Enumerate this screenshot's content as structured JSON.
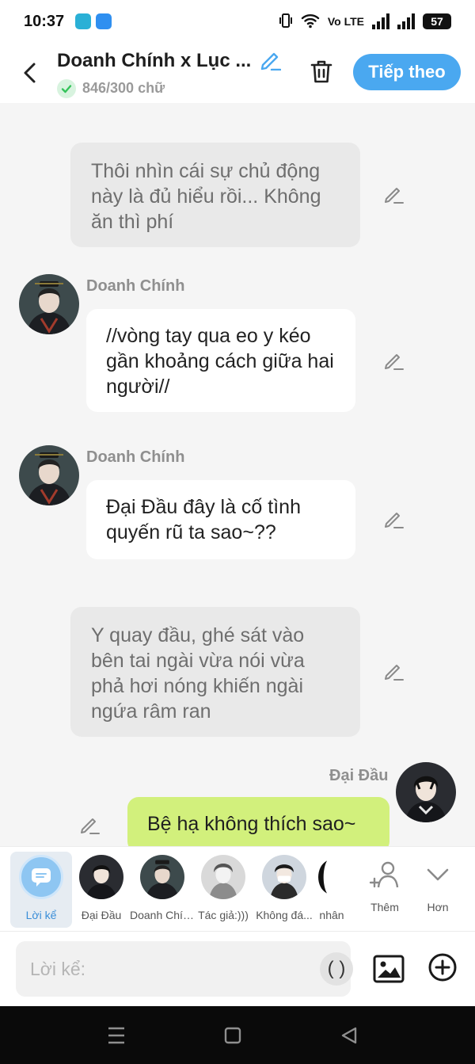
{
  "status_bar": {
    "time": "10:37",
    "network_label": "Vo LTE",
    "battery": "57"
  },
  "header": {
    "title": "Doanh Chính x Lục ...",
    "word_count": "846/300 chữ",
    "next_button": "Tiếp theo"
  },
  "messages": [
    {
      "type": "narration",
      "text": "Thôi nhìn cái sự chủ động này là đủ hiểu rồi... Không ăn thì phí"
    },
    {
      "type": "character",
      "sender": "Doanh Chính",
      "text": "//vòng tay qua eo y kéo gần khoảng cách giữa hai người//"
    },
    {
      "type": "character",
      "sender": "Doanh Chính",
      "text": "Đại Đầu đây là cố tình quyến rũ ta sao~??"
    },
    {
      "type": "narration",
      "text": "Y quay đầu, ghé sát vào bên tai ngài vừa nói vừa phả hơi nóng khiến ngài ngứa râm ran"
    },
    {
      "type": "user",
      "sender": "Đại Đầu",
      "text": "Bệ hạ không thích sao~"
    }
  ],
  "roles": [
    {
      "label": "Lời kể",
      "selected": true
    },
    {
      "label": "Đại Đầu"
    },
    {
      "label": "Doanh Chính"
    },
    {
      "label": "Tác giả:)))"
    },
    {
      "label": "Không đá..."
    },
    {
      "label": "nhân"
    }
  ],
  "actions": {
    "add_label": "Thêm",
    "more_label": "Hơn"
  },
  "input": {
    "placeholder": "Lời kể:",
    "paren_label": "( )"
  },
  "colors": {
    "accent": "#4aa8f0",
    "user_bubble": "#d2f07c",
    "narration_bubble": "#e9e9e9",
    "background": "#f5f5f5"
  }
}
